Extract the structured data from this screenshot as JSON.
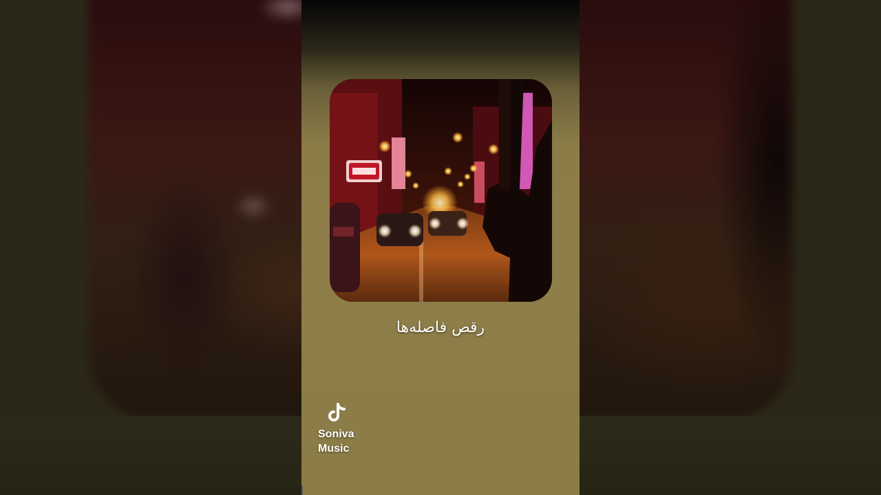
{
  "video": {
    "song_title": "رقص فاصله‌ها",
    "watermark": {
      "logo_icon": "tiktok-note-icon",
      "channel_name": "Soniva\nMusic"
    }
  },
  "colors": {
    "panel_background": "#8b7c47",
    "title_text": "#ffffff",
    "outer_background": "#2b2818"
  }
}
